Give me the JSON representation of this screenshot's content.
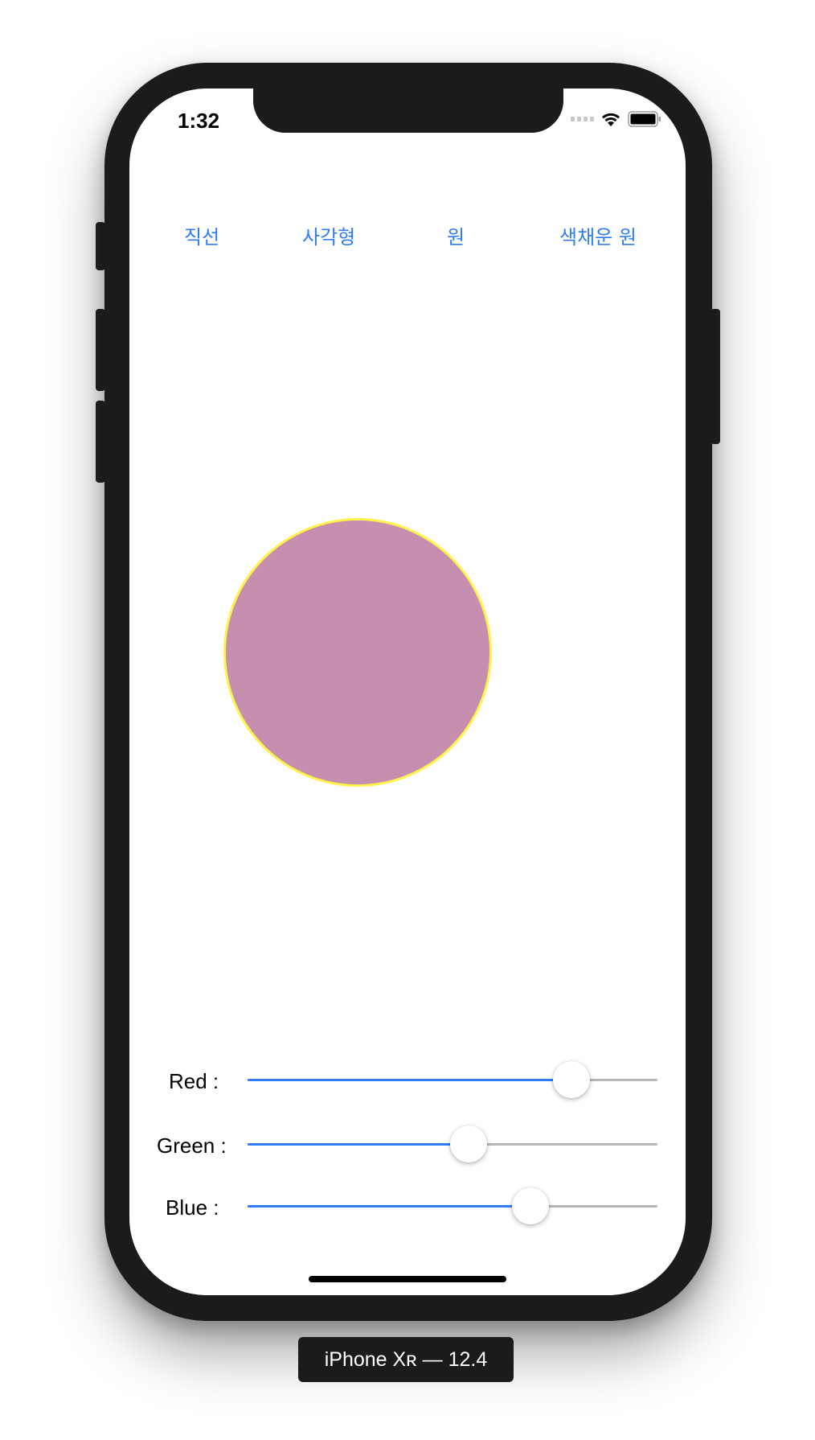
{
  "status_bar": {
    "time": "1:32"
  },
  "toolbar": {
    "buttons": [
      {
        "label": "직선"
      },
      {
        "label": "사각형"
      },
      {
        "label": "원"
      },
      {
        "label": "색채운 원"
      }
    ]
  },
  "canvas": {
    "shape": "circle",
    "fill_color": "#c68eaf",
    "stroke_color": "#fff24a"
  },
  "sliders": [
    {
      "label": "Red :",
      "value": 0.79
    },
    {
      "label": "Green :",
      "value": 0.54
    },
    {
      "label": "Blue :",
      "value": 0.69
    }
  ],
  "colors": {
    "accent": "#2f7cf6",
    "track": "#b5b5b5"
  },
  "device_caption": "iPhone Xʀ — 12.4"
}
